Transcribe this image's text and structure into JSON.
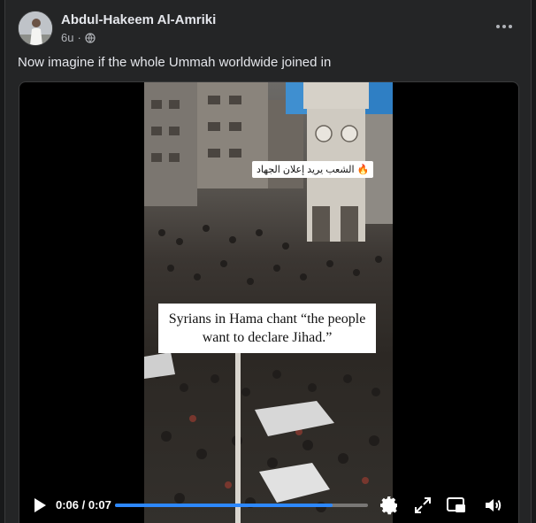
{
  "post": {
    "author": "Abdul-Hakeem Al-Amriki",
    "time": "6u",
    "separator": "·",
    "caption": "Now imagine if the whole Ummah worldwide joined in",
    "more_icon": "more-horizontal-icon",
    "audience_icon": "globe-icon"
  },
  "video": {
    "hashtag_text": "الشعب يريد إعلان الجهاد 🔥",
    "banner_text": "Syrians in Hama chant “the people want to declare Jihad.”",
    "current_time": "0:06",
    "duration": "0:07",
    "time_display": "0:06 / 0:07",
    "progress_fraction": 0.86,
    "accent_color": "#2d88ff",
    "controls": [
      "play-icon",
      "settings-icon",
      "fullscreen-icon",
      "picture-in-picture-icon",
      "volume-icon"
    ]
  }
}
